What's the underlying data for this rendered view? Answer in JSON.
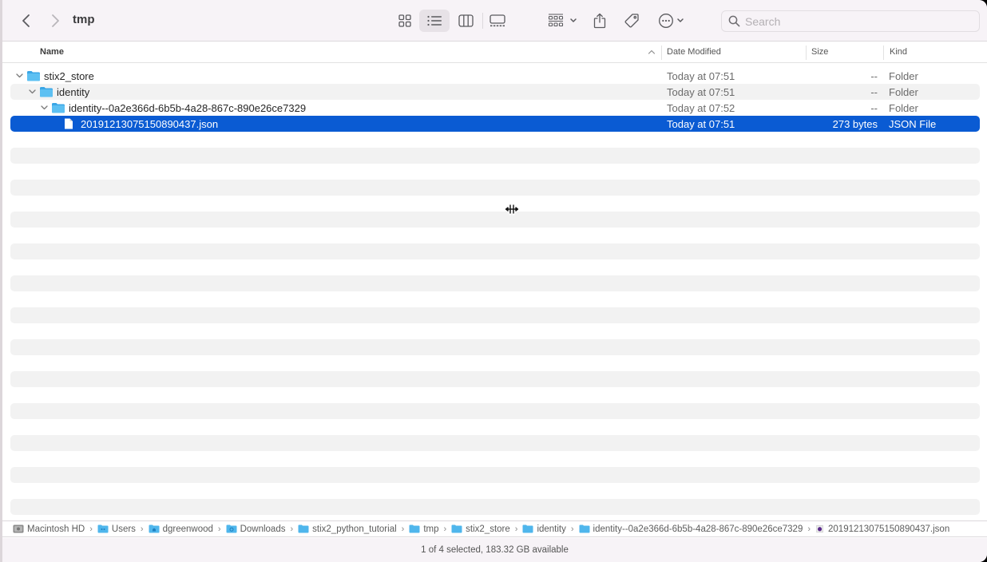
{
  "window": {
    "title": "tmp"
  },
  "toolbar": {
    "back_icon": "chevron-left-icon",
    "forward_icon": "chevron-right-icon",
    "view_modes": [
      "icons",
      "list",
      "columns",
      "gallery"
    ],
    "active_view": "list",
    "group_icon": "group-grid-icon",
    "share_icon": "share-icon",
    "tag_icon": "tag-icon",
    "more_icon": "ellipsis-circle-icon",
    "search_placeholder": "Search",
    "search_value": ""
  },
  "columns": {
    "name": "Name",
    "date": "Date Modified",
    "size": "Size",
    "kind": "Kind",
    "sort_indicator": "^"
  },
  "rows": [
    {
      "name": "stix2_store",
      "date": "Today at 07:51",
      "size": "--",
      "kind": "Folder",
      "type": "folder",
      "expanded": true,
      "depth": 0
    },
    {
      "name": "identity",
      "date": "Today at 07:51",
      "size": "--",
      "kind": "Folder",
      "type": "folder",
      "expanded": true,
      "depth": 1
    },
    {
      "name": "identity--0a2e366d-6b5b-4a28-867c-890e26ce7329",
      "date": "Today at 07:52",
      "size": "--",
      "kind": "Folder",
      "type": "folder",
      "expanded": true,
      "depth": 2
    },
    {
      "name": "20191213075150890437.json",
      "date": "Today at 07:51",
      "size": "273 bytes",
      "kind": "JSON File",
      "type": "file",
      "selected": true,
      "depth": 3
    }
  ],
  "pathbar": [
    {
      "label": "Macintosh HD",
      "icon": "hard-drive-icon"
    },
    {
      "label": "Users",
      "icon": "users-folder-icon"
    },
    {
      "label": "dgreenwood",
      "icon": "home-folder-icon"
    },
    {
      "label": "Downloads",
      "icon": "downloads-folder-icon"
    },
    {
      "label": "stix2_python_tutorial",
      "icon": "folder-icon"
    },
    {
      "label": "tmp",
      "icon": "folder-icon"
    },
    {
      "label": "stix2_store",
      "icon": "folder-icon"
    },
    {
      "label": "identity",
      "icon": "folder-icon"
    },
    {
      "label": "identity--0a2e366d-6b5b-4a28-867c-890e26ce7329",
      "icon": "folder-icon"
    },
    {
      "label": "20191213075150890437.json",
      "icon": "json-file-icon"
    }
  ],
  "status": {
    "text": "1 of 4 selected, 183.32 GB available"
  },
  "colors": {
    "selection": "#0a5bd3",
    "folder": "#4fb6ec",
    "toolbar_bg": "#f7f3f7",
    "stripe": "#f2f2f2"
  }
}
